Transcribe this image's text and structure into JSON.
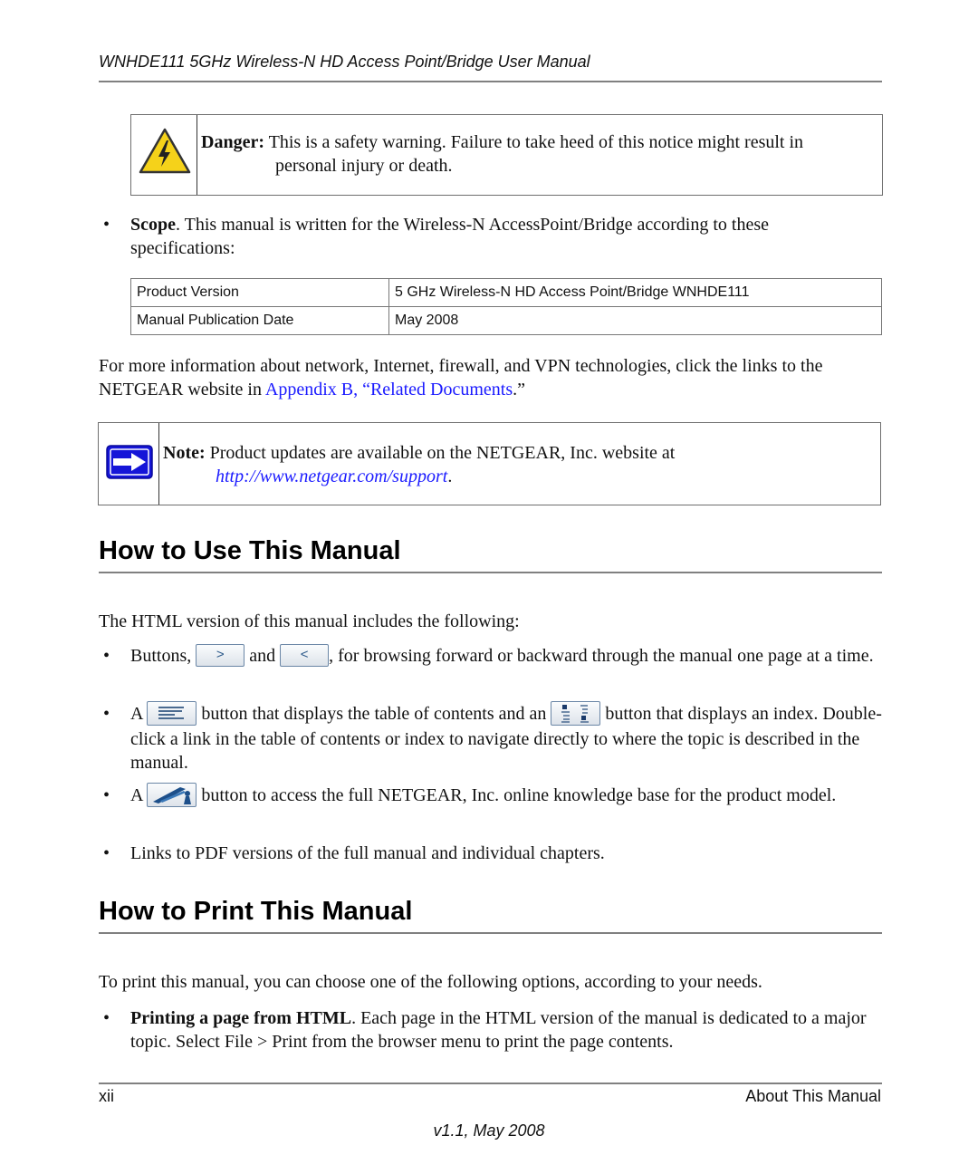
{
  "header": {
    "title": "WNHDE111 5GHz Wireless-N HD Access Point/Bridge User Manual"
  },
  "danger_callout": {
    "icon": "warning-high-voltage-icon",
    "label": "Danger:",
    "text": " This is a safety warning. Failure to take heed of this notice might result in",
    "text_cont": "personal injury or death."
  },
  "scope": {
    "bullet": "•",
    "label": "Scope",
    "text": ". This manual is written for the Wireless-N AccessPoint/Bridge according to these specifications:"
  },
  "spec_table": {
    "rows": [
      {
        "label": "Product Version",
        "value": "5 GHz Wireless-N HD Access Point/Bridge WNHDE111"
      },
      {
        "label": "Manual Publication Date",
        "value": "May 2008"
      }
    ]
  },
  "more_info": {
    "text_before": "For more information about network, Internet, firewall, and VPN technologies, click the links to the NETGEAR website in ",
    "link": "Appendix B, “Related Documents",
    "text_after": ".”"
  },
  "note_callout": {
    "icon": "arrow-right-icon",
    "label": "Note:",
    "text": " Product updates are available on the NETGEAR, Inc. website at",
    "link": "http://www.netgear.com/support",
    "link_suffix": "."
  },
  "section_use": {
    "heading": "How to Use This Manual",
    "intro": "The HTML version of this manual includes the following:",
    "items": [
      {
        "bullet": "•",
        "prefix": "Buttons, ",
        "button_next": ">",
        "middle": " and ",
        "button_prev": "<",
        "suffix": ", for browsing forward or backward through the manual one page at a time."
      },
      {
        "bullet": "•",
        "prefix": "A ",
        "toc_icon": "table-of-contents-icon",
        "middle": " button that displays the table of contents and an ",
        "index_icon": "index-icon",
        "suffix": " button that displays an index. Double-click a link in the table of contents or index to navigate directly to where the topic is described in the manual."
      },
      {
        "bullet": "•",
        "prefix": "A ",
        "kb_icon": "knowledge-base-icon",
        "suffix": " button to access the full NETGEAR, Inc. online knowledge base for the product model."
      },
      {
        "bullet": "•",
        "text": "Links to PDF versions of the full manual and individual chapters."
      }
    ]
  },
  "section_print": {
    "heading": "How to Print This Manual",
    "intro": "To print this manual, you can choose one of the following options, according to your needs.",
    "items": [
      {
        "bullet": "•",
        "label": "Printing a page from HTML",
        "text": ". Each page in the HTML version of the manual is dedicated to a major topic. Select File > Print from the browser menu to print the page contents."
      }
    ]
  },
  "footer": {
    "page_number": "xii",
    "section": "About This Manual",
    "version": "v1.1, May 2008"
  },
  "colors": {
    "link": "#1a1aff",
    "warning_yellow": "#f5d21a",
    "note_blue": "#1515d8",
    "rule_gray": "#808080"
  }
}
